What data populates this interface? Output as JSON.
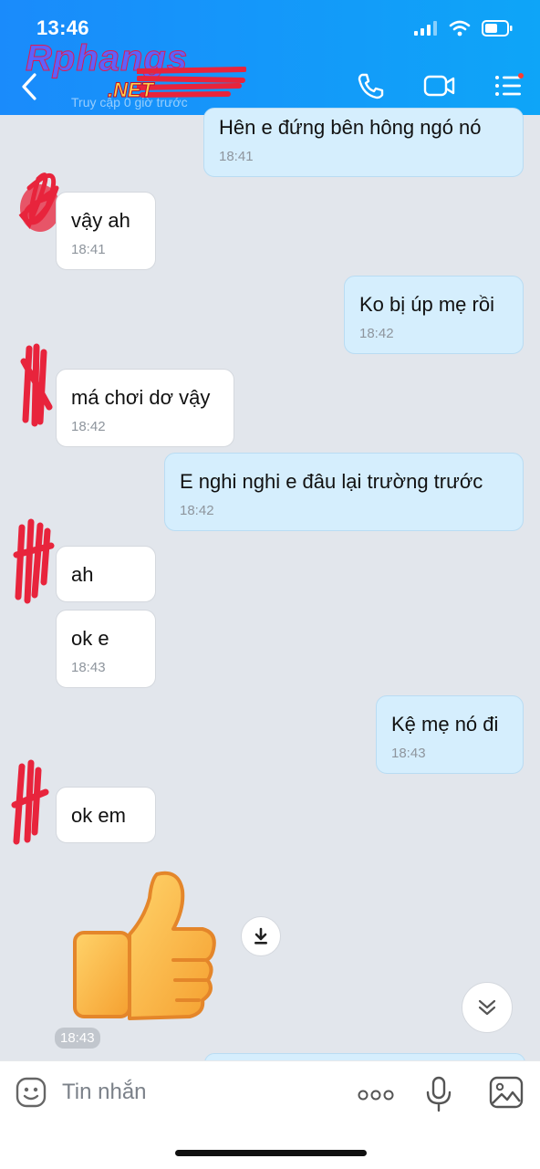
{
  "status_bar": {
    "time": "13:46"
  },
  "header": {
    "subtitle": "Truy cập 0 giờ trước",
    "watermark": "Rphangs",
    "watermark_sub": ".NET"
  },
  "messages": [
    {
      "side": "out",
      "text": "Hên e đứng bên hông ngó nó",
      "time": "18:41"
    },
    {
      "side": "in",
      "text": "vậy ah",
      "time": "18:41"
    },
    {
      "side": "out",
      "text": "Ko bị úp mẹ rồi",
      "time": "18:42"
    },
    {
      "side": "in",
      "text": "má chơi dơ vậy",
      "time": "18:42"
    },
    {
      "side": "out",
      "text": "E nghi nghi e đâu lại trường trước",
      "time": "18:42"
    },
    {
      "side": "in",
      "text": "ah",
      "time": ""
    },
    {
      "side": "in",
      "text": "ok e",
      "time": "18:43"
    },
    {
      "side": "out",
      "text": "Kệ mẹ nó đi",
      "time": "18:43"
    },
    {
      "side": "in",
      "text": "ok em",
      "time": ""
    }
  ],
  "sticker": {
    "icon": "thumbs-up-sticker",
    "time": "18:43"
  },
  "input": {
    "placeholder": "Tin nhắn"
  },
  "colors": {
    "header": "#1a8bfb",
    "outgoing_bubble": "#d5eefd",
    "incoming_bubble": "#ffffff",
    "background": "#e2e6ec"
  }
}
